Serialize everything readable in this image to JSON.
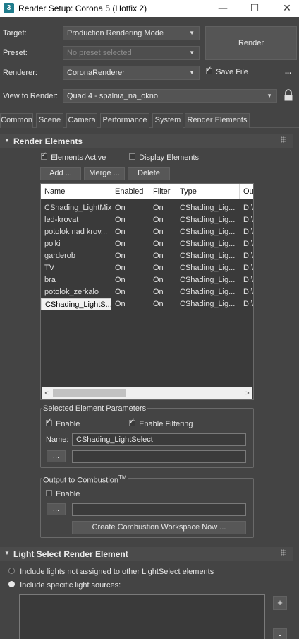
{
  "window": {
    "title": "Render Setup: Corona 5 (Hotfix 2)",
    "icon_label": "3",
    "minimize": "—",
    "maximize": "☐",
    "close": "✕"
  },
  "setup": {
    "target_label": "Target:",
    "target_value": "Production Rendering Mode",
    "preset_label": "Preset:",
    "preset_value": "No preset selected",
    "renderer_label": "Renderer:",
    "renderer_value": "CoronaRenderer",
    "save_file_label": "Save File",
    "save_file_checked": true,
    "more_label": "...",
    "view_label": "View to Render:",
    "view_value": "Quad 4 - spalnia_na_okno",
    "render_button": "Render"
  },
  "tabs": [
    "Common",
    "Scene",
    "Camera",
    "Performance",
    "System",
    "Render Elements"
  ],
  "active_tab": "Render Elements",
  "render_elements": {
    "rollout_title": "Render Elements",
    "elements_active_label": "Elements Active",
    "elements_active_checked": true,
    "display_elements_label": "Display Elements",
    "display_elements_checked": false,
    "add_button": "Add ...",
    "merge_button": "Merge ...",
    "delete_button": "Delete",
    "columns": [
      "Name",
      "Enabled",
      "Filter",
      "Type",
      "Ou"
    ],
    "rows": [
      [
        "CShading_LightMix",
        "On",
        "On",
        "CShading_Lig...",
        "D:\\"
      ],
      [
        "led-krovat",
        "On",
        "On",
        "CShading_Lig...",
        "D:\\"
      ],
      [
        "potolok nad krov...",
        "On",
        "On",
        "CShading_Lig...",
        "D:\\"
      ],
      [
        "polki",
        "On",
        "On",
        "CShading_Lig...",
        "D:\\"
      ],
      [
        "garderob",
        "On",
        "On",
        "CShading_Lig...",
        "D:\\"
      ],
      [
        "TV",
        "On",
        "On",
        "CShading_Lig...",
        "D:\\"
      ],
      [
        "bra",
        "On",
        "On",
        "CShading_Lig...",
        "D:\\"
      ],
      [
        "potolok_zerkalo",
        "On",
        "On",
        "CShading_Lig...",
        "D:\\"
      ],
      [
        "CShading_LightS...",
        "On",
        "On",
        "CShading_Lig...",
        "D:\\"
      ]
    ],
    "selected_row": 8,
    "scroll_left": "<",
    "scroll_right": ">"
  },
  "selected_params": {
    "group_title": "Selected Element Parameters",
    "enable_label": "Enable",
    "enable_checked": true,
    "enable_filtering_label": "Enable Filtering",
    "enable_filtering_checked": true,
    "name_label": "Name:",
    "name_value": "CShading_LightSelect",
    "browse_button": "...",
    "path_value": ""
  },
  "combustion": {
    "group_title": "Output to Combustion",
    "tm": "TM",
    "enable_label": "Enable",
    "enable_checked": false,
    "browse_button": "...",
    "path_value": "",
    "create_button": "Create Combustion Workspace Now ..."
  },
  "light_select": {
    "rollout_title": "Light Select Render Element",
    "option_not_assigned": "Include lights not assigned to other LightSelect elements",
    "option_specific": "Include specific light sources:",
    "selected_option": "specific",
    "add_button": "+",
    "remove_button": "-"
  }
}
